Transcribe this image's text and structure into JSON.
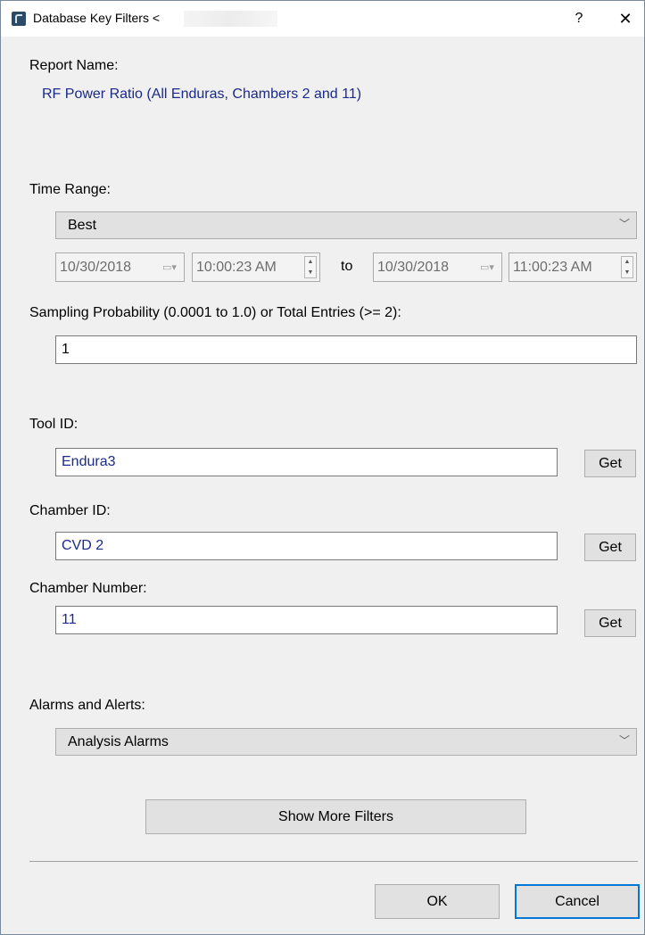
{
  "window": {
    "title": "Database Key Filters <",
    "help_label": "?",
    "close_label": "✕"
  },
  "icons": {
    "app": "app-icon",
    "help": "help-icon",
    "close": "close-icon",
    "calendar": "calendar-icon",
    "spin_up": "spin-up-icon",
    "spin_down": "spin-down-icon",
    "dropdown": "chevron-down-icon"
  },
  "report": {
    "label": "Report Name:",
    "value": "RF Power Ratio (All Enduras, Chambers 2 and 11)"
  },
  "time_range": {
    "label": "Time Range:",
    "selected": "Best",
    "start_date": "10/30/2018",
    "start_time": "10:00:23 AM",
    "to_label": "to",
    "end_date": "10/30/2018",
    "end_time": "11:00:23 AM"
  },
  "sampling": {
    "label": "Sampling Probability (0.0001 to 1.0) or Total Entries (>= 2):",
    "value": "1"
  },
  "tool": {
    "label": "Tool ID:",
    "value": "Endura3",
    "get_label": "Get"
  },
  "chamber": {
    "label": "Chamber ID:",
    "value": "CVD 2",
    "get_label": "Get"
  },
  "chamber_number": {
    "label": "Chamber Number:",
    "value": "11",
    "get_label": "Get"
  },
  "alarms": {
    "label": "Alarms and Alerts:",
    "selected": "Analysis Alarms"
  },
  "buttons": {
    "show_more": "Show More Filters",
    "ok": "OK",
    "cancel": "Cancel"
  },
  "colors": {
    "value_text": "#1a2a8a",
    "focus_border": "#0078d7",
    "button_bg": "#e1e1e1",
    "dialog_bg": "#f0f0f0"
  }
}
